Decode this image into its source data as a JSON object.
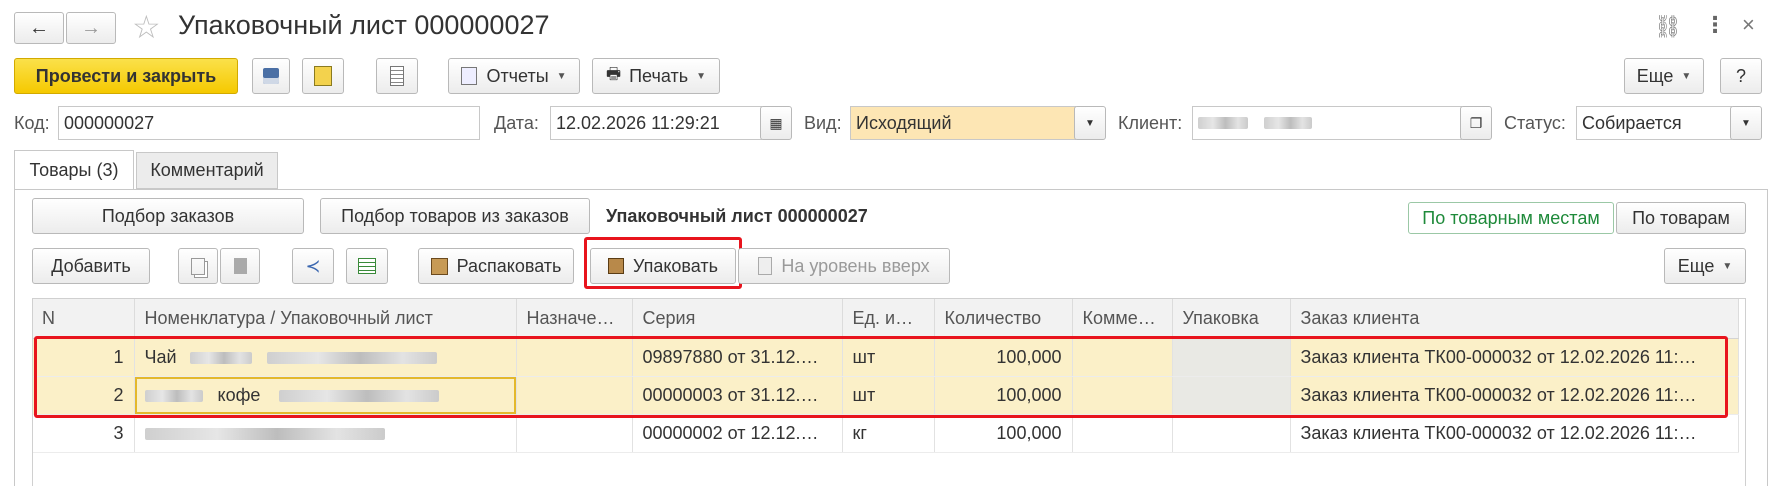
{
  "window": {
    "title": "Упаковочный лист 000000027"
  },
  "toolbar": {
    "post_close": "Провести и закрыть",
    "reports": "Отчеты",
    "print": "Печать",
    "more": "Еще",
    "help": "?"
  },
  "header": {
    "code_label": "Код:",
    "code_value": "000000027",
    "date_label": "Дата:",
    "date_value": "12.02.2026 11:29:21",
    "kind_label": "Вид:",
    "kind_value": "Исходящий",
    "client_label": "Клиент:",
    "status_label": "Статус:",
    "status_value": "Собирается"
  },
  "tabs": [
    {
      "label": "Товары (3)"
    },
    {
      "label": "Комментарий"
    }
  ],
  "goods": {
    "pick_orders": "Подбор заказов",
    "pick_goods": "Подбор товаров из заказов",
    "doc_title": "Упаковочный лист 000000027",
    "by_places": "По товарным местам",
    "by_goods": "По товарам",
    "add": "Добавить",
    "unpack": "Распаковать",
    "pack": "Упаковать",
    "level_up": "На уровень вверх",
    "more": "Еще"
  },
  "table": {
    "columns": [
      "N",
      "Номенклатура / Упаковочный лист",
      "Назначе…",
      "Серия",
      "Ед. и…",
      "Количество",
      "Комме…",
      "Упаковка",
      "Заказ клиента"
    ],
    "rows": [
      {
        "n": "1",
        "name": "Чай",
        "series": "09897880 от 31.12.…",
        "unit": "шт",
        "qty": "100,000",
        "order": "Заказ клиента ТК00-000032 от 12.02.2026 11:…"
      },
      {
        "n": "2",
        "name": "кофе",
        "series": "00000003 от 31.12.…",
        "unit": "шт",
        "qty": "100,000",
        "order": "Заказ клиента ТК00-000032 от 12.02.2026 11:…"
      },
      {
        "n": "3",
        "name": "",
        "series": "00000002 от 12.12.…",
        "unit": "кг",
        "qty": "100,000",
        "order": "Заказ клиента ТК00-000032 от 12.02.2026 11:…"
      }
    ]
  },
  "colors": {
    "accent_yellow": "#f5c900",
    "highlight_red": "#e8141d",
    "selected_row": "#fbf0c8"
  }
}
